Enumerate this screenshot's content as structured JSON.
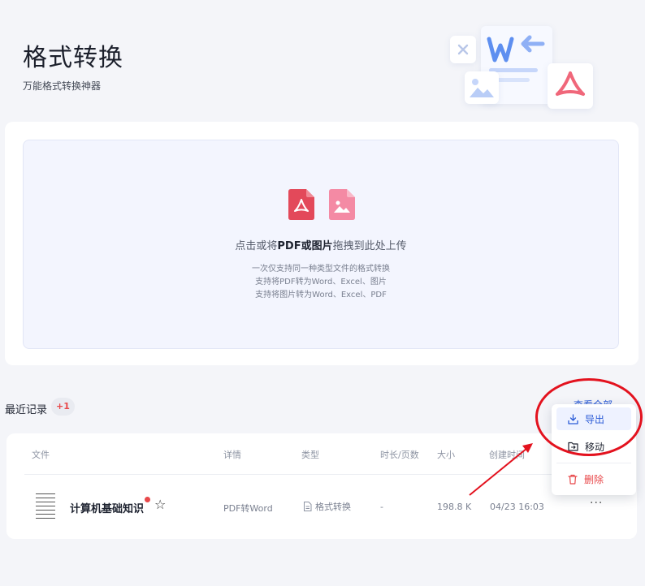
{
  "header": {
    "title": "格式转换",
    "subtitle": "万能格式转换神器"
  },
  "upload": {
    "main_prefix": "点击或将",
    "main_bold": "PDF或图片",
    "main_suffix": "拖拽到此处上传",
    "hint1": "一次仅支持同一种类型文件的格式转换",
    "hint2": "支持将PDF转为Word、Excel、图片",
    "hint3": "支持将图片转为Word、Excel、PDF"
  },
  "recent": {
    "title": "最近记录",
    "badge": "+1",
    "view_all": "查看全部"
  },
  "table": {
    "headers": [
      "文件",
      "详情",
      "类型",
      "时长/页数",
      "大小",
      "创建时间"
    ],
    "rows": [
      {
        "name": "计算机基础知识",
        "detail": "PDF转Word",
        "type": "格式转换",
        "duration": "-",
        "size": "198.8 K",
        "created": "04/23 16:03",
        "more": "···"
      }
    ]
  },
  "context_menu": {
    "export": "导出",
    "move": "移动",
    "delete": "删除"
  },
  "colors": {
    "accent": "#2b5bd7",
    "pdf_red": "#e3495a",
    "image_pink": "#f48aa4",
    "danger": "#e8484a",
    "annotation": "#e3121e"
  }
}
